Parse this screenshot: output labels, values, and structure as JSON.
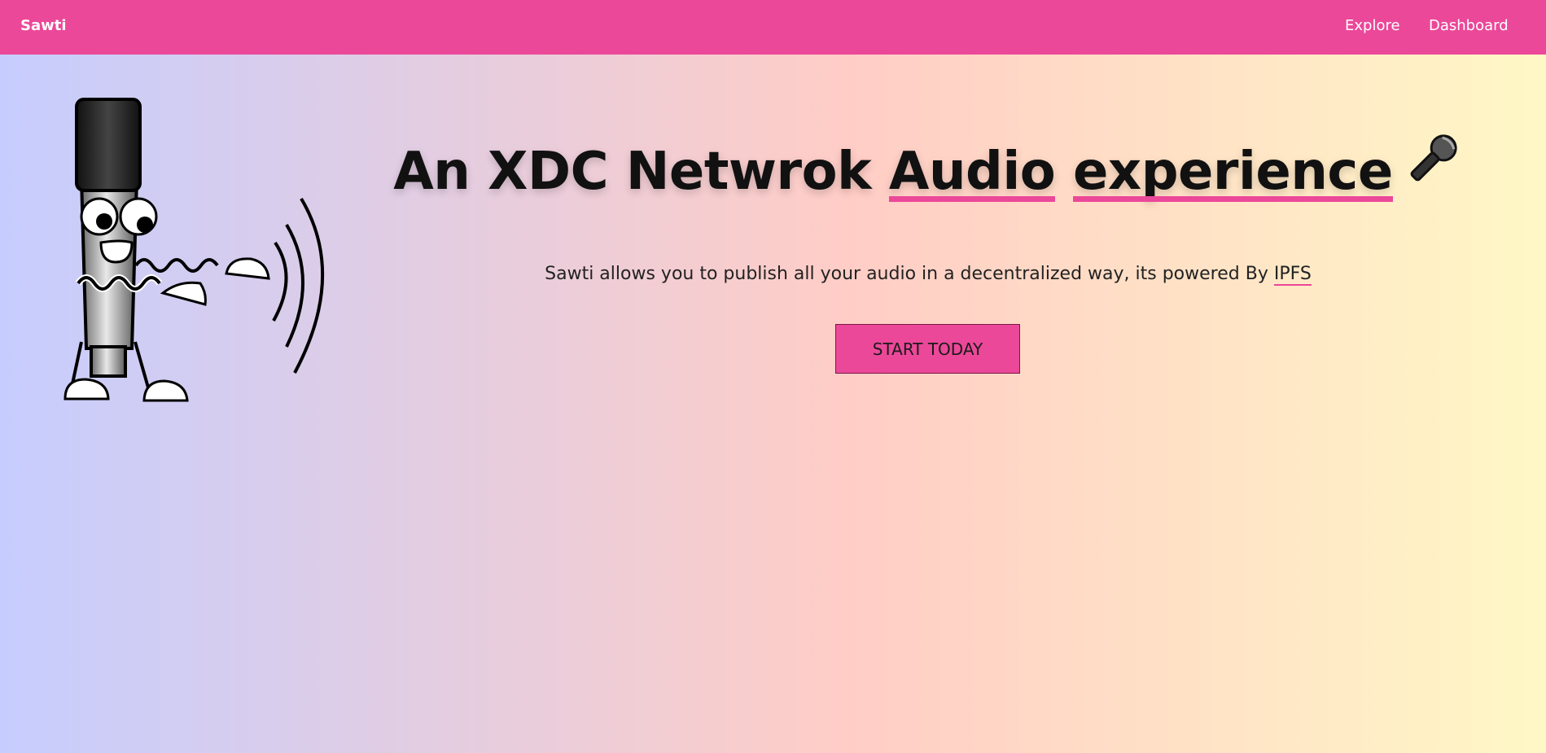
{
  "nav": {
    "brand": "Sawti",
    "links": [
      "Explore",
      "Dashboard"
    ]
  },
  "hero": {
    "title_plain": "An XDC Netwrok ",
    "title_word1": "Audio",
    "title_word2": "experience",
    "title_emoji": "🎤",
    "subtitle": "Sawti allows you to publish all your audio in a decentralized way, its powered By ",
    "subtitle_link": "IPFS",
    "cta_label": "START TODAY"
  },
  "colors": {
    "accent": "#eb4899",
    "gradient": [
      "#c6cdfe",
      "#ffcdc6",
      "#fff8c6"
    ]
  },
  "icons": {
    "mascot": "singing-microphone-mascot",
    "title_emoji": "microphone-icon"
  }
}
